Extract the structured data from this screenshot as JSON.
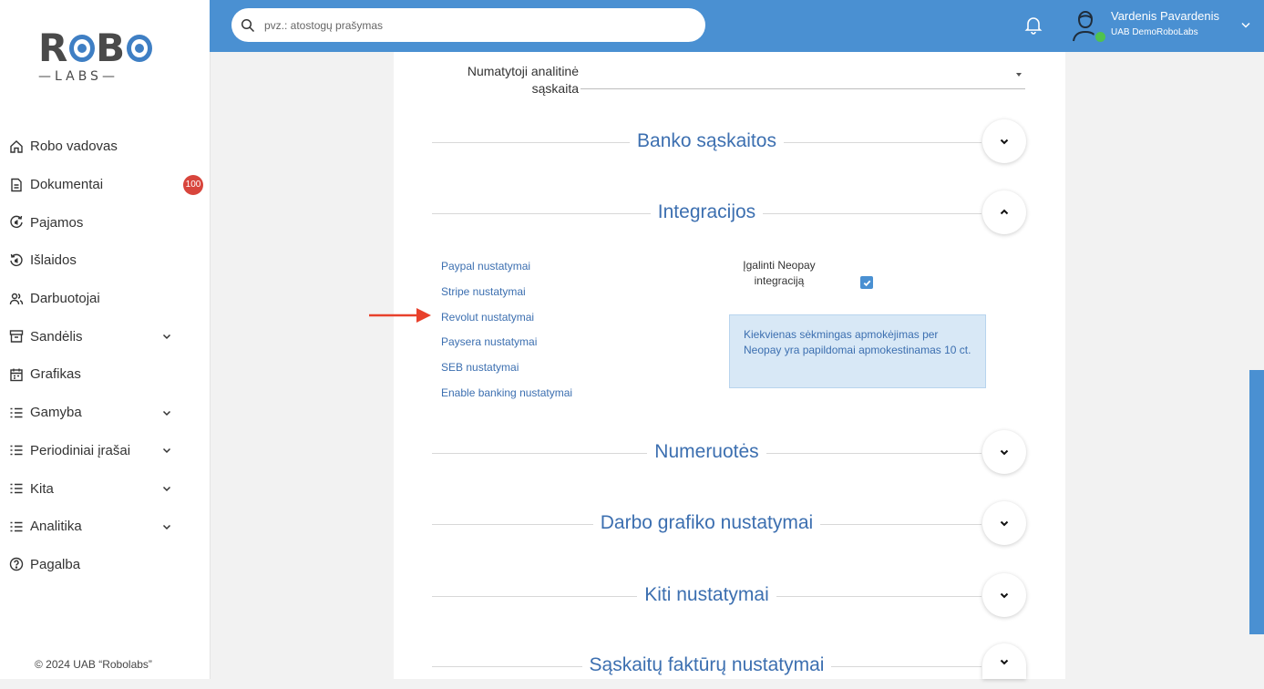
{
  "sidebar": {
    "logo": {
      "top": "ROBO",
      "bottom": "LABS"
    },
    "items": [
      {
        "label": "Robo vadovas",
        "icon": "home-icon",
        "chevron": false
      },
      {
        "label": "Dokumentai",
        "icon": "document-icon",
        "chevron": false,
        "badge": "100"
      },
      {
        "label": "Pajamos",
        "icon": "income-icon",
        "chevron": false
      },
      {
        "label": "Išlaidos",
        "icon": "expense-icon",
        "chevron": false
      },
      {
        "label": "Darbuotojai",
        "icon": "users-icon",
        "chevron": false
      },
      {
        "label": "Sandėlis",
        "icon": "warehouse-icon",
        "chevron": true
      },
      {
        "label": "Grafikas",
        "icon": "calendar-icon",
        "chevron": false
      },
      {
        "label": "Gamyba",
        "icon": "list-icon",
        "chevron": true
      },
      {
        "label": "Periodiniai įrašai",
        "icon": "list-icon",
        "chevron": true
      },
      {
        "label": "Kita",
        "icon": "list-icon",
        "chevron": true
      },
      {
        "label": "Analitika",
        "icon": "list-icon",
        "chevron": true
      },
      {
        "label": "Pagalba",
        "icon": "help-icon",
        "chevron": false
      }
    ],
    "copyright": "© 2024 UAB “Robolabs”"
  },
  "header": {
    "search_placeholder": "pvz.: atostogų prašymas",
    "user_name": "Vardenis Pavardenis",
    "company": "UAB DemoRoboLabs"
  },
  "settings": {
    "analytic_account_label": "Numatytoji analitinė sąskaita",
    "sections": {
      "banks": "Banko sąskaitos",
      "integrations": "Integracijos",
      "numbering": "Numeruotės",
      "schedule": "Darbo grafiko nustatymai",
      "other": "Kiti nustatymai",
      "invoices": "Sąskaitų faktūrų nustatymai"
    },
    "integration_links": [
      "Paypal nustatymai",
      "Stripe nustatymai",
      "Revolut nustatymai",
      "Paysera nustatymai",
      "SEB nustatymai",
      "Enable banking nustatymai"
    ],
    "neopay_label": "Įgalinti Neopay integraciją",
    "neopay_enabled": true,
    "neopay_info": "Kiekvienas sėkmingas apmokėjimas per Neopay yra papildomai apmokestinamas 10 ct."
  },
  "colors": {
    "accent": "#4a90d2",
    "heading": "#3c6fb0",
    "badge": "#d8453c",
    "arrow": "#e8412c"
  }
}
